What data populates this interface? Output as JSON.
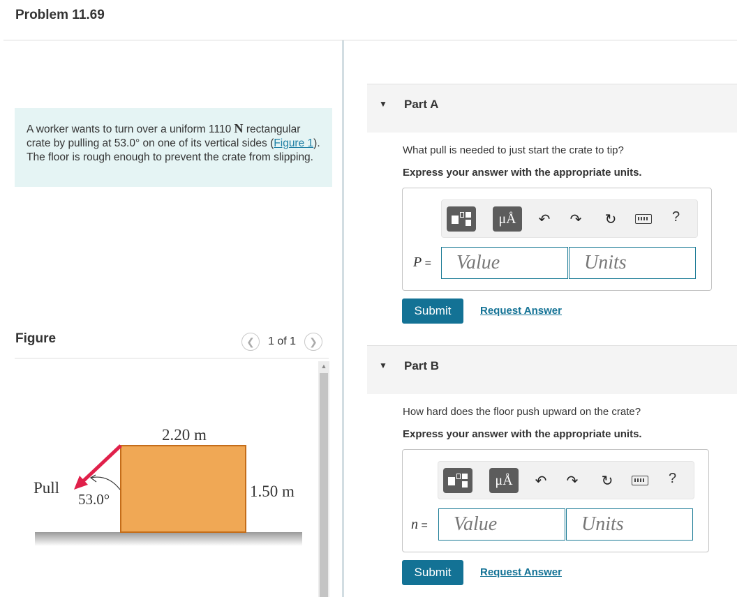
{
  "title": "Problem 11.69",
  "problem": {
    "text_1": "A worker wants to turn over a uniform 1110 ",
    "weight_unit": "N",
    "text_2": " rectangular crate by pulling at 53.0° on one of its vertical sides (",
    "figure_link": "Figure 1",
    "text_3": "). The floor is rough enough to prevent the crate from slipping."
  },
  "figure": {
    "label": "Figure",
    "counter": "1 of 1",
    "prev_icon": "chevron-left-icon",
    "next_icon": "chevron-right-icon",
    "width_label": "2.20 m",
    "height_label": "1.50 m",
    "pull_label": "Pull",
    "angle_label": "53.0°",
    "crate_color": "#f0a855",
    "arrow_color": "#e0204a"
  },
  "parts": [
    {
      "title": "Part A",
      "question": "What pull is needed to just start the crate to tip?",
      "instruction": "Express your answer with the appropriate units.",
      "variable": "P",
      "equals": "=",
      "value_placeholder": "Value",
      "units_placeholder": "Units",
      "submit_label": "Submit",
      "request_label": "Request Answer"
    },
    {
      "title": "Part B",
      "question": "How hard does the floor push upward on the crate?",
      "instruction": "Express your answer with the appropriate units.",
      "variable": "n",
      "equals": "=",
      "value_placeholder": "Value",
      "units_placeholder": "Units",
      "submit_label": "Submit",
      "request_label": "Request Answer"
    }
  ],
  "toolbar": {
    "templates_icon": "templates-icon",
    "units_label": "μÅ",
    "undo_icon": "undo-icon",
    "redo_icon": "redo-icon",
    "reset_icon": "reset-icon",
    "keyboard_icon": "keyboard-icon",
    "help_label": "?"
  },
  "colors": {
    "accent": "#137295",
    "link": "#1f7fa4",
    "problem_bg": "#e5f4f4"
  }
}
